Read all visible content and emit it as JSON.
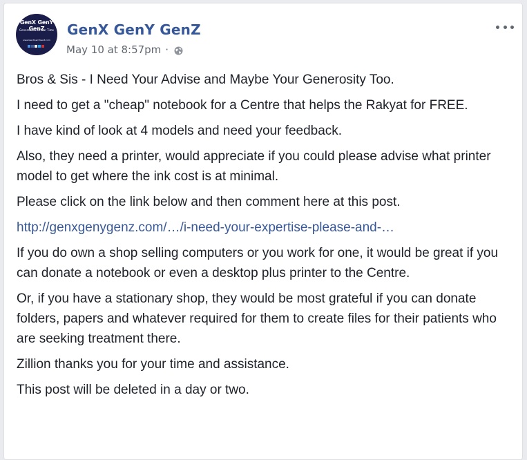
{
  "post": {
    "avatar": {
      "brand_text": "GenX GenY GenZ",
      "tagline": "Generations Of Our Time",
      "url_text": "www.GenXGenYGenZ.com"
    },
    "page_name": "GenX GenY GenZ",
    "timestamp": "May 10 at 8:57pm",
    "separator": "·",
    "privacy_icon": "globe-icon",
    "more_icon": "more-options-icon",
    "paragraphs": [
      "Bros & Sis - I Need Your Advise and Maybe Your Generosity Too.",
      "I need to get a \"cheap\" notebook for a Centre that helps the Rakyat for FREE.",
      "I have kind of look at 4 models and need your feedback.",
      "Also, they need a printer, would appreciate if you could please advise what printer model to get where the ink cost is at minimal.",
      "Please click on the link below and then comment here at this post."
    ],
    "link_text": "http://genxgenygenz.com/…/i-need-your-expertise-please-and-…",
    "paragraphs_after": [
      "If you do own a shop selling computers or you work for one, it would be great if you can donate a notebook or even a desktop plus printer to the Centre.",
      "Or, if you have a stationary shop, they would be most grateful if you can donate folders, papers and whatever required for them to create files for their patients who are seeking treatment there.",
      "Zillion thanks you for your time and assistance.",
      "This post will be deleted in a day or two."
    ]
  },
  "colors": {
    "page_name": "#365899",
    "link": "#385898",
    "meta_text": "#616770",
    "body_text": "#1d2129",
    "background": "#e9ebee"
  }
}
